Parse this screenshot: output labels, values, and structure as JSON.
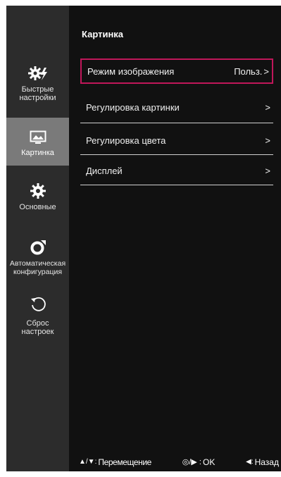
{
  "sidebar": {
    "items": [
      {
        "label": "Быстрые\nнастройки",
        "icon": "quick-settings-icon",
        "active": false
      },
      {
        "label": "Картинка",
        "icon": "picture-icon",
        "active": true
      },
      {
        "label": "Основные",
        "icon": "gear-icon",
        "active": false
      },
      {
        "label": "Автоматическая\nконфигурация",
        "icon": "auto-config-icon",
        "active": false
      },
      {
        "label": "Сброс\nнастроек",
        "icon": "reset-icon",
        "active": false
      }
    ]
  },
  "main": {
    "title": "Картинка",
    "rows": [
      {
        "label": "Режим изображения",
        "value": "Польз.",
        "arrow": ">"
      },
      {
        "label": "Регулировка картинки",
        "arrow": ">"
      },
      {
        "label": "Регулировка цвета",
        "arrow": ">"
      },
      {
        "label": "Дисплей",
        "arrow": ">"
      }
    ]
  },
  "footer": {
    "move_keys": "▲/▼:",
    "move_label": "Перемещение",
    "ok_keys": "◎/▶ :",
    "ok_label": "OK",
    "back_keys": "◀:",
    "back_label": "Назад"
  },
  "colors": {
    "panel_bg": "#111111",
    "sidebar_bg": "#2c2c2c",
    "sidebar_active_bg": "#7a7a7a",
    "selection_border": "#c0175a",
    "text": "#ffffff"
  }
}
